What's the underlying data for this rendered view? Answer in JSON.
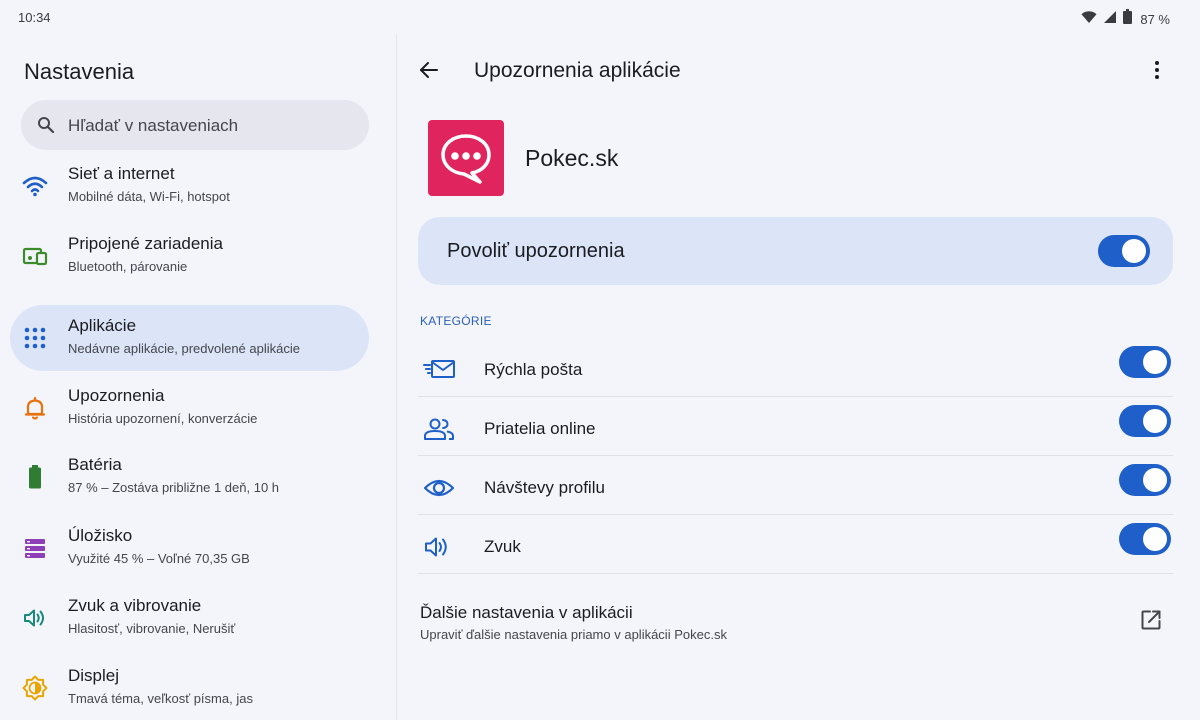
{
  "status_bar": {
    "time": "10:34",
    "battery_percent": "87 %",
    "icons": [
      "wifi-icon",
      "signal-icon",
      "battery-icon"
    ]
  },
  "left_pane": {
    "title": "Nastavenia",
    "search": {
      "placeholder": "Hľadať v nastaveniach",
      "icon": "search-icon"
    },
    "items": [
      {
        "label": "Sieť a internet",
        "sub": "Mobilné dáta, Wi-Fi, hotspot",
        "icon": "wifi-icon",
        "color": "#1F5FC9",
        "selected": false
      },
      {
        "label": "Pripojené zariadenia",
        "sub": "Bluetooth, párovanie",
        "icon": "devices-icon",
        "color": "#3C8C2B",
        "selected": false
      },
      {
        "label": "Aplikácie",
        "sub": "Nedávne aplikácie, predvolené aplikácie",
        "icon": "apps-grid-icon",
        "color": "#1F5FC9",
        "selected": true
      },
      {
        "label": "Upozornenia",
        "sub": "História upozornení, konverzácie",
        "icon": "bell-icon",
        "color": "#E8710A",
        "selected": false
      },
      {
        "label": "Batéria",
        "sub": "87 % – Zostáva približne 1 deň, 10 h",
        "icon": "battery-icon",
        "color": "#2E7D32",
        "selected": false
      },
      {
        "label": "Úložisko",
        "sub": "Využité 45 % – Voľné 70,35 GB",
        "icon": "storage-icon",
        "color": "#8E3FB8",
        "selected": false
      },
      {
        "label": "Zvuk a vibrovanie",
        "sub": "Hlasitosť, vibrovanie, Nerušiť",
        "icon": "volume-icon",
        "color": "#17897B",
        "selected": false
      },
      {
        "label": "Displej",
        "sub": "Tmavá téma, veľkosť písma, jas",
        "icon": "brightness-icon",
        "color": "#E7A500",
        "selected": false
      }
    ]
  },
  "right_pane": {
    "title": "Upozornenia aplikácie",
    "app": {
      "name": "Pokec.sk",
      "icon": "chat-bubble-icon",
      "color": "#E0245E"
    },
    "master_toggle": {
      "label": "Povoliť upozornenia",
      "on": true
    },
    "section_header": "KATEGÓRIE",
    "categories": [
      {
        "label": "Rýchla pošta",
        "icon": "fast-mail-icon",
        "on": true
      },
      {
        "label": "Priatelia online",
        "icon": "people-icon",
        "on": true
      },
      {
        "label": "Návštevy profilu",
        "icon": "eye-icon",
        "on": true
      },
      {
        "label": "Zvuk",
        "icon": "volume-icon",
        "on": true
      }
    ],
    "more_settings": {
      "title": "Ďalšie nastavenia v aplikácii",
      "sub": "Upraviť ďalšie nastavenia priamo v aplikácii Pokec.sk",
      "icon": "open-external-icon"
    }
  },
  "colors": {
    "accent": "#1F5FC9",
    "selected_bg": "#DCE4F8",
    "background": "#F4F5FB"
  }
}
